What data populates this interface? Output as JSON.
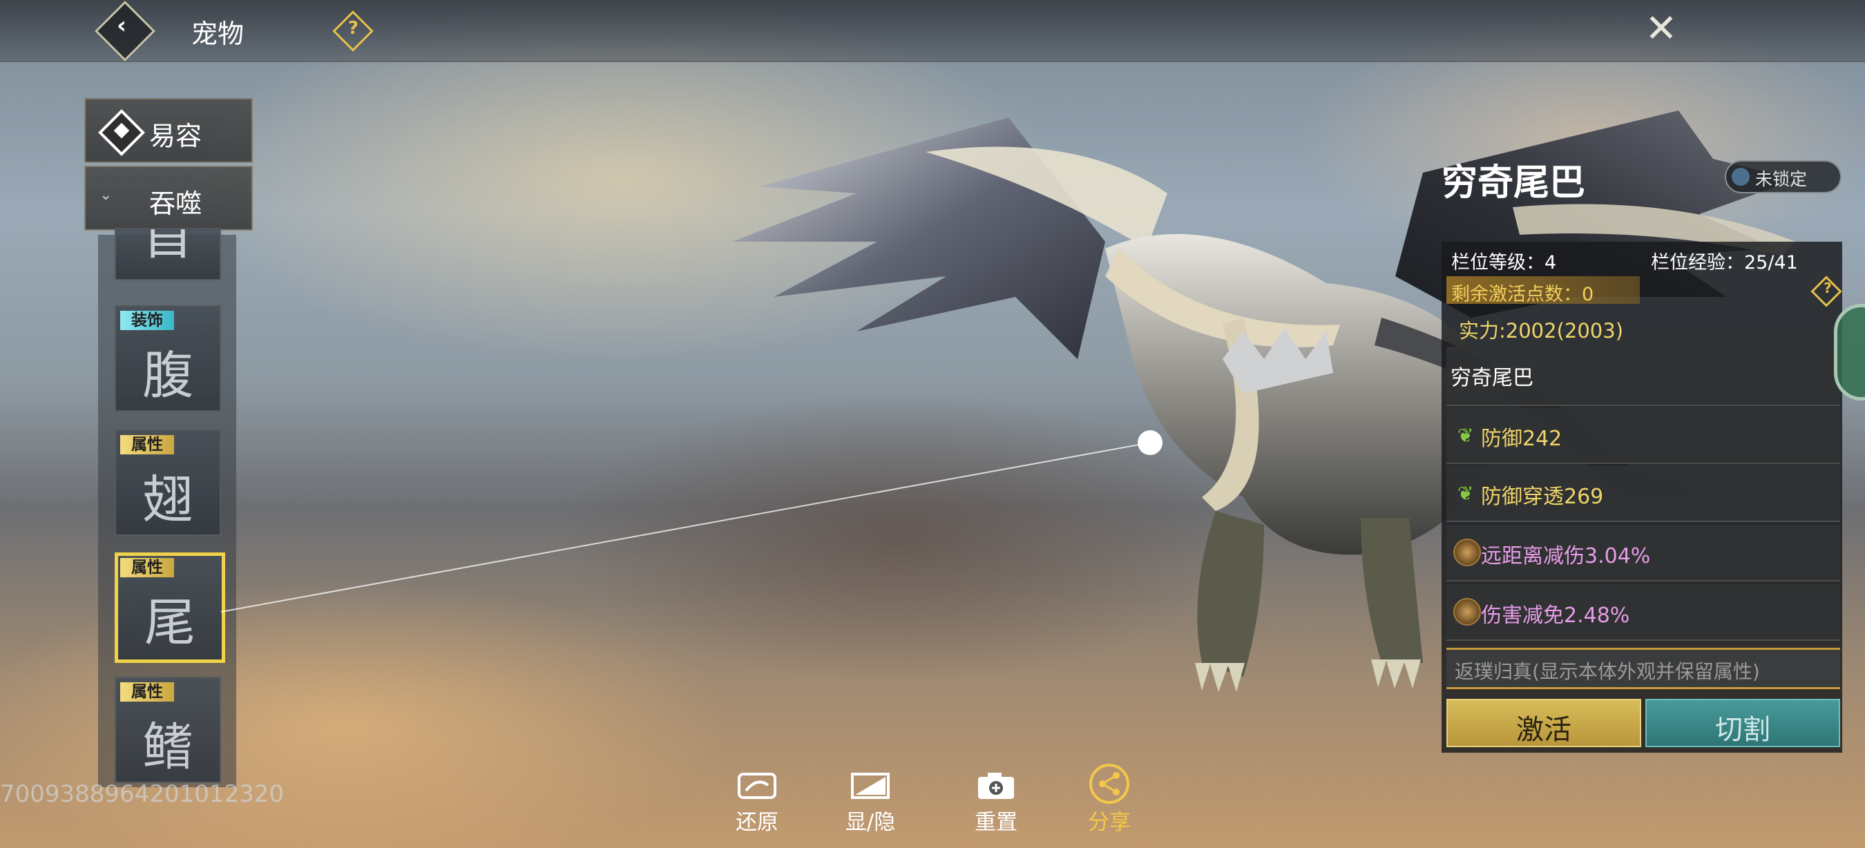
{
  "header": {
    "title": "宠物",
    "back_icon": "back-arrow-icon",
    "help_icon": "help-icon",
    "close_icon": "close-icon"
  },
  "sidebar": {
    "tabs": [
      {
        "label": "易容",
        "icon": "disguise-icon"
      },
      {
        "label": "吞噬",
        "icon": "chevron-down-icon"
      }
    ],
    "slots": [
      {
        "tag": "",
        "glyph": "首"
      },
      {
        "tag": "装饰",
        "glyph": "腹"
      },
      {
        "tag": "属性",
        "glyph": "翅"
      },
      {
        "tag": "属性",
        "glyph": "尾",
        "selected": true
      },
      {
        "tag": "属性",
        "glyph": "鳍"
      }
    ]
  },
  "player_id": "7009388964201012320",
  "toolbar": {
    "restore_label": "还原",
    "toggle_label": "显/隐",
    "reset_label": "重置",
    "share_label": "分享"
  },
  "panel": {
    "title": "穷奇尾巴",
    "lock_status": "未锁定",
    "slot_level": "栏位等级：4",
    "slot_exp": "栏位经验：25/41",
    "remaining_points": "剩余激活点数：0",
    "power": "实力:2002(2003)",
    "name_row": "穷奇尾巴",
    "attributes": [
      {
        "text": "防御242",
        "color": "#f0d56a",
        "icon": "leaf-icon"
      },
      {
        "text": "防御穿透269",
        "color": "#f0d56a",
        "icon": "leaf-icon"
      },
      {
        "text": "远距离减伤3.04%",
        "color": "#e79ce8",
        "icon": "orb-icon"
      },
      {
        "text": "伤害减免2.48%",
        "color": "#e79ce8",
        "icon": "orb-icon"
      }
    ],
    "note": "返璞归真(显示本体外观并保留属性)",
    "activate_label": "激活",
    "cut_label": "切割"
  },
  "colors": {
    "accent_gold": "#f0d34a",
    "teal": "#3a8a8a",
    "lavender": "#e79ce8"
  }
}
